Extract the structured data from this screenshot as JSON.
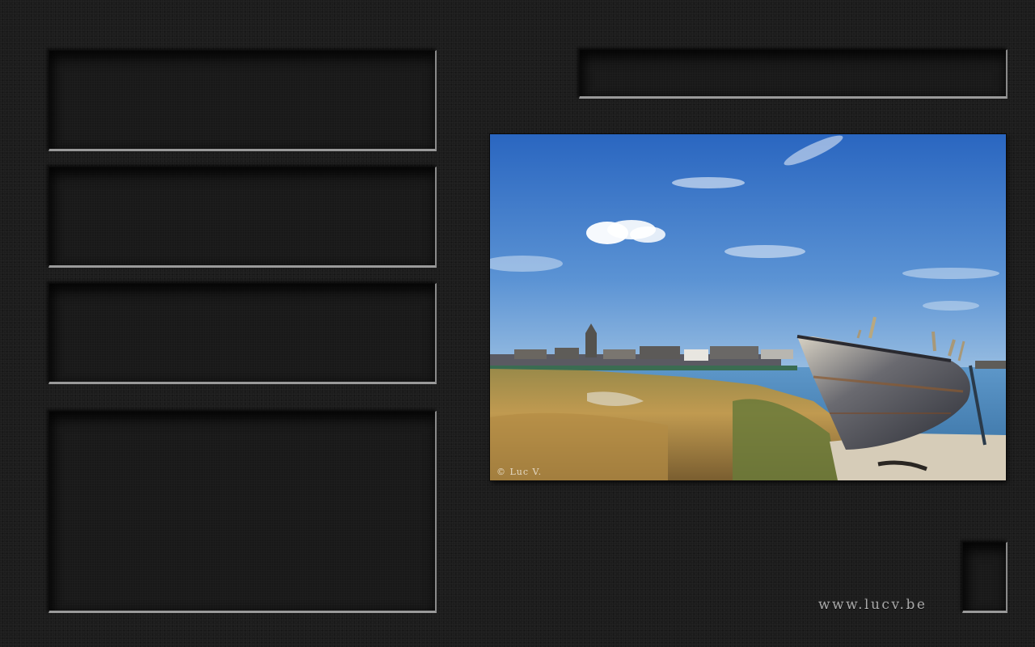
{
  "photo": {
    "credit": "© Luc V.",
    "subject": "landscape-photo"
  },
  "footer": {
    "url": "www.lucv.be"
  },
  "colors": {
    "background": "#1c1c1c",
    "panel": "#181818",
    "panel_highlight": "#9a9a9a",
    "sky_top": "#2f6cc2",
    "sky_bottom": "#8fb8e0",
    "water": "#4a84b8",
    "grass": "#b09048"
  }
}
